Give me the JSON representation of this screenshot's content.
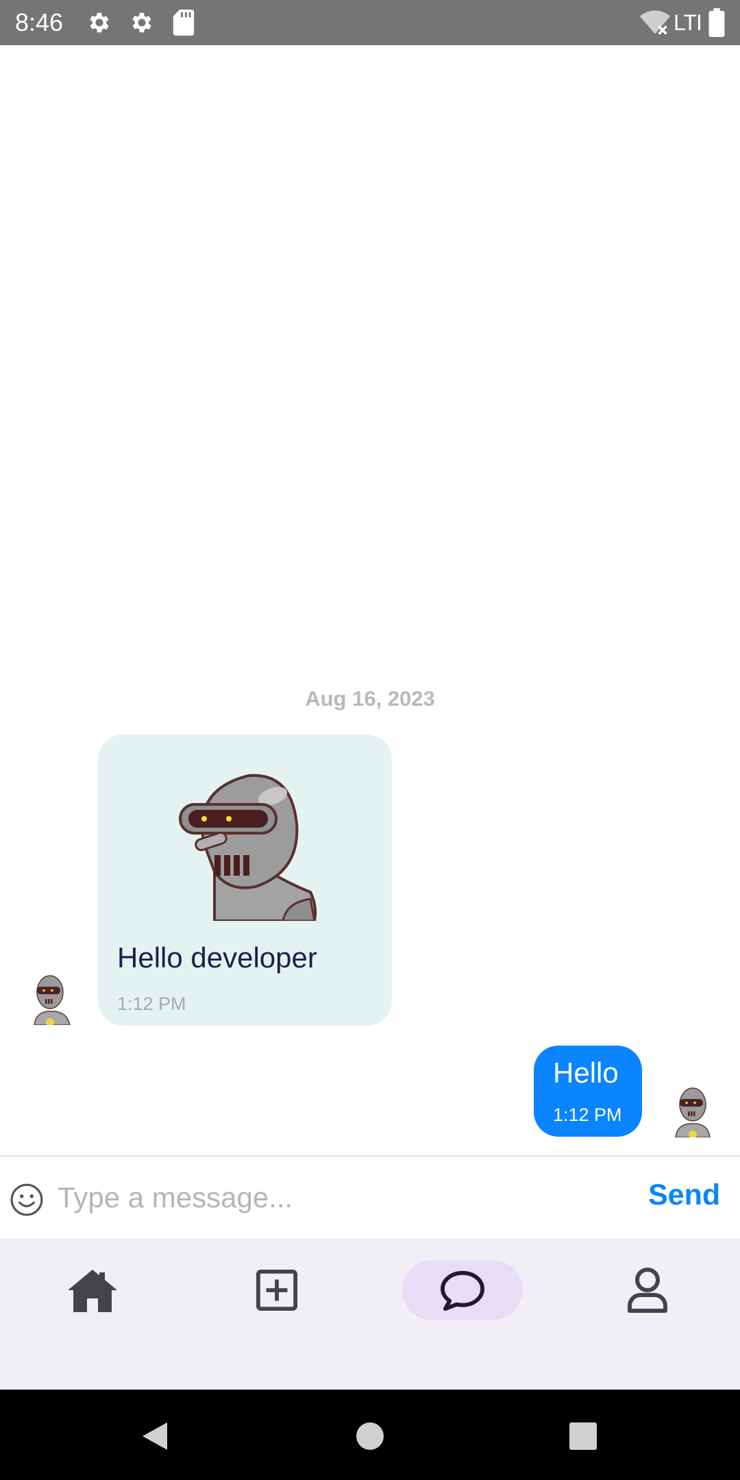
{
  "status_bar": {
    "time": "8:46",
    "network": "LTI",
    "icons": [
      "settings-icon",
      "settings-icon",
      "sd-card-icon",
      "wifi-off-icon",
      "battery-icon"
    ]
  },
  "chat": {
    "date_separator": "Aug 16, 2023",
    "messages": [
      {
        "direction": "incoming",
        "has_sticker": true,
        "sticker": "robot-sticker",
        "text": "Hello developer",
        "time": "1:12 PM",
        "avatar": "robot-avatar"
      },
      {
        "direction": "outgoing",
        "text": "Hello",
        "time": "1:12 PM",
        "avatar": "robot-avatar"
      }
    ]
  },
  "composer": {
    "placeholder": "Type a message...",
    "value": "",
    "send_label": "Send",
    "emoji_icon": "smiley-icon"
  },
  "bottom_nav": {
    "items": [
      {
        "icon": "home-icon",
        "active": false
      },
      {
        "icon": "add-square-icon",
        "active": false
      },
      {
        "icon": "chat-bubble-icon",
        "active": true
      },
      {
        "icon": "person-icon",
        "active": false
      }
    ]
  },
  "system_nav": [
    "back-icon",
    "home-circle-icon",
    "recents-icon"
  ],
  "colors": {
    "accent": "#0a84ff",
    "incoming_bubble": "#e4f3f2",
    "nav_background": "#f2eef6",
    "nav_active_pill": "#e6def6",
    "status_bar": "#757575"
  }
}
